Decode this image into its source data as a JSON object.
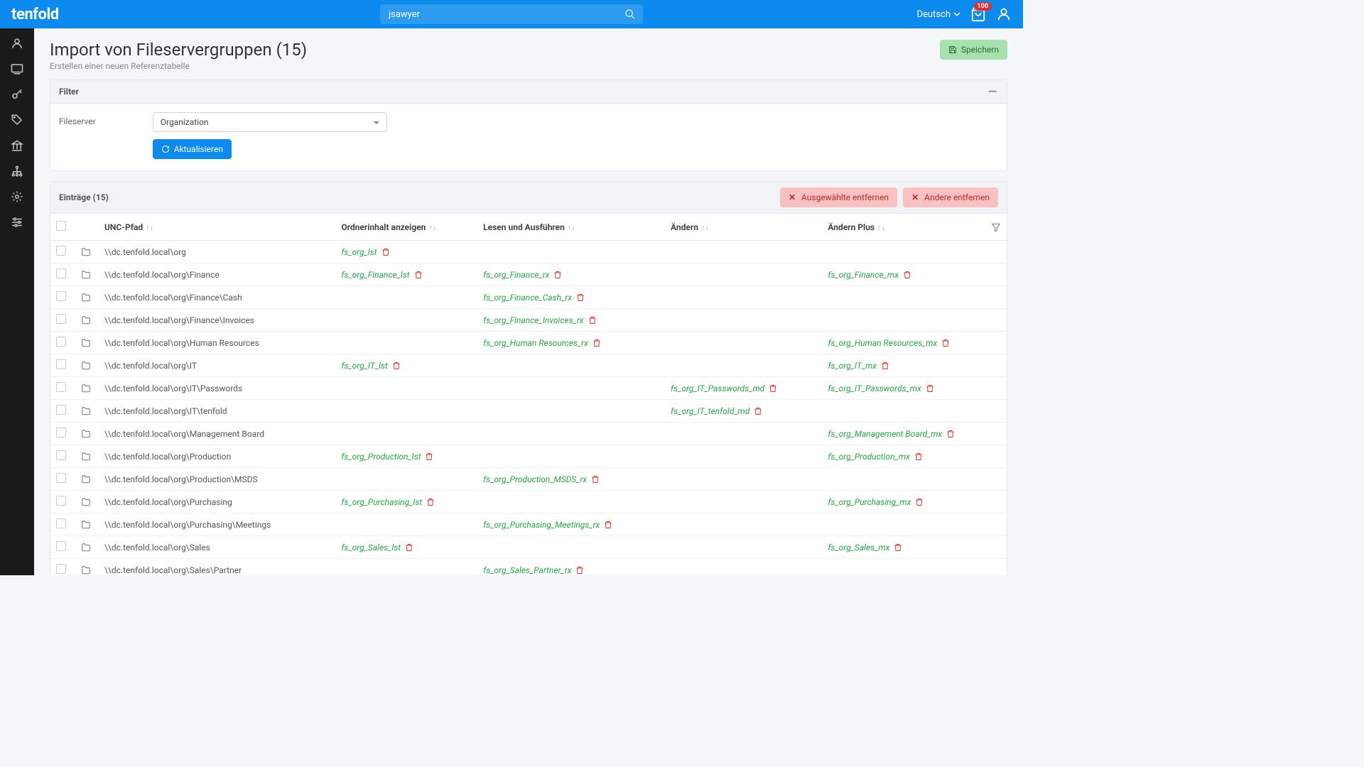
{
  "brand": "tenfold",
  "search": {
    "value": "jsawyer"
  },
  "language": "Deutsch",
  "cart_badge": "100",
  "page": {
    "title": "Import von Fileservergruppen (15)",
    "subtitle": "Erstellen einer neuen Referenztabelle",
    "save": "Speichern"
  },
  "filter": {
    "heading": "Filter",
    "label": "Fileserver",
    "select_value": "Organization",
    "refresh": "Aktualisieren"
  },
  "entries": {
    "heading": "Einträge (15)",
    "remove_selected": "Ausgewählte entfernen",
    "remove_others": "Andere entfernen",
    "cols": {
      "unc": "UNC-Pfad",
      "list": "Ordnerinhalt anzeigen",
      "read": "Lesen und Ausführen",
      "modify": "Ändern",
      "modify_plus": "Ändern Plus"
    }
  },
  "rows": [
    {
      "path": "\\\\dc.tenfold.local\\org",
      "lst": "fs_org_lst"
    },
    {
      "path": "\\\\dc.tenfold.local\\org\\Finance",
      "lst": "fs_org_Finance_lst",
      "rx": "fs_org_Finance_rx",
      "mx": "fs_org_Finance_mx"
    },
    {
      "path": "\\\\dc.tenfold.local\\org\\Finance\\Cash",
      "rx": "fs_org_Finance_Cash_rx"
    },
    {
      "path": "\\\\dc.tenfold.local\\org\\Finance\\Invoices",
      "rx": "fs_org_Finance_Invoices_rx"
    },
    {
      "path": "\\\\dc.tenfold.local\\org\\Human Resources",
      "rx": "fs_org_Human Resources_rx",
      "mx": "fs_org_Human Resources_mx"
    },
    {
      "path": "\\\\dc.tenfold.local\\org\\IT",
      "lst": "fs_org_IT_lst",
      "mx": "fs_org_IT_mx"
    },
    {
      "path": "\\\\dc.tenfold.local\\org\\IT\\Passwords",
      "md": "fs_org_IT_Passwords_md",
      "mx": "fs_org_IT_Passwords_mx"
    },
    {
      "path": "\\\\dc.tenfold.local\\org\\IT\\tenfold",
      "md": "fs_org_IT_tenfold_md"
    },
    {
      "path": "\\\\dc.tenfold.local\\org\\Management Board",
      "mx": "fs_org_Management Board_mx"
    },
    {
      "path": "\\\\dc.tenfold.local\\org\\Production",
      "lst": "fs_org_Production_lst",
      "mx": "fs_org_Production_mx"
    },
    {
      "path": "\\\\dc.tenfold.local\\org\\Production\\MSDS",
      "rx": "fs_org_Production_MSDS_rx"
    },
    {
      "path": "\\\\dc.tenfold.local\\org\\Purchasing",
      "lst": "fs_org_Purchasing_lst",
      "mx": "fs_org_Purchasing_mx"
    },
    {
      "path": "\\\\dc.tenfold.local\\org\\Purchasing\\Meetings",
      "rx": "fs_org_Purchasing_Meetings_rx"
    },
    {
      "path": "\\\\dc.tenfold.local\\org\\Sales",
      "lst": "fs_org_Sales_lst",
      "mx": "fs_org_Sales_mx"
    },
    {
      "path": "\\\\dc.tenfold.local\\org\\Sales\\Partner",
      "rx": "fs_org_Sales_Partner_rx"
    }
  ]
}
